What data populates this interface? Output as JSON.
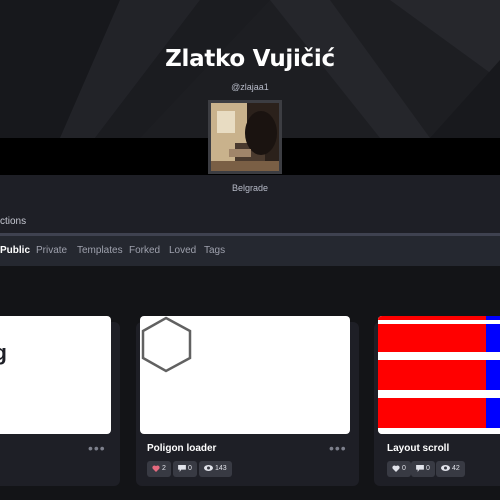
{
  "profile": {
    "name": "Zlatko Vujičić",
    "handle": "@zlajaa1",
    "location": "Belgrade"
  },
  "sections": {
    "partial_tab": "ctions"
  },
  "filters": [
    {
      "label": "Public",
      "active": true
    },
    {
      "label": "Private"
    },
    {
      "label": "Templates"
    },
    {
      "label": "Forked"
    },
    {
      "label": "Loved"
    },
    {
      "label": "Tags"
    }
  ],
  "pens": [
    {
      "preview_text": "ng",
      "more": "•••"
    },
    {
      "title": "Poligon loader",
      "more": "•••",
      "loves": "2",
      "comments": "0",
      "views": "143"
    },
    {
      "title": "Layout scroll",
      "loves": "0",
      "comments": "0",
      "views": "42"
    }
  ],
  "colors": {
    "page_bg": "#131417",
    "card_bg": "#1e1f26",
    "filter_bar_bg": "#252830",
    "love_icon": "#e66a7f",
    "layout_red": "#ff0000",
    "layout_blue": "#0000ff"
  },
  "icons": {
    "love": "heart-icon",
    "comment": "comment-icon",
    "view": "eye-icon",
    "more": "more-dots-icon"
  }
}
